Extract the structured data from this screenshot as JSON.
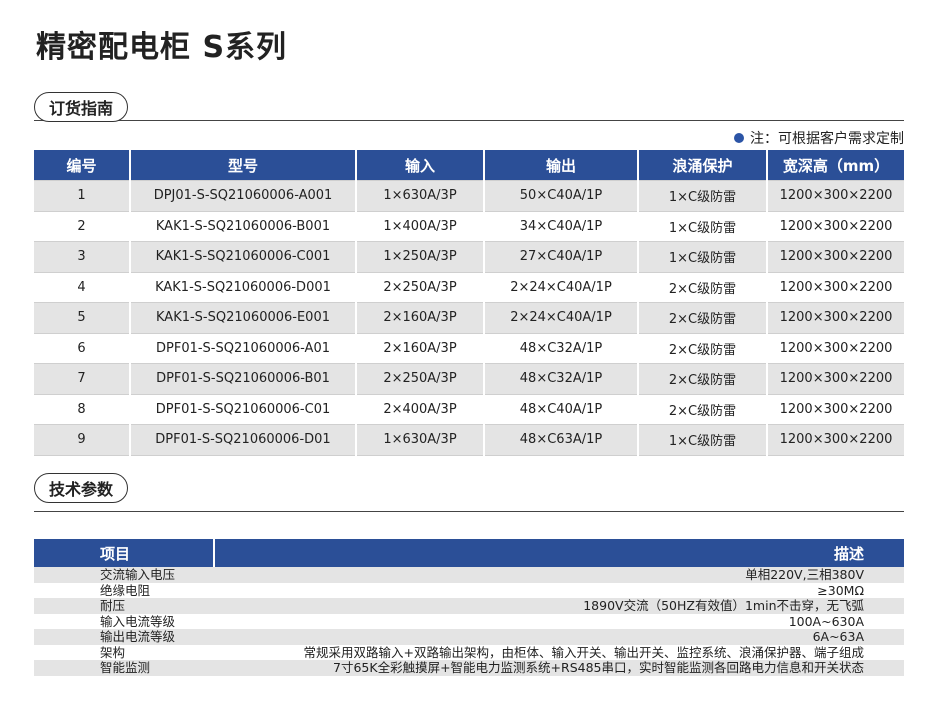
{
  "page": {
    "title": "精密配电柜 S系列"
  },
  "order_section": {
    "label": "订货指南",
    "note": "注：可根据客户需求定制",
    "columns": [
      "编号",
      "型号",
      "输入",
      "输出",
      "浪涌保护",
      "宽深高（mm）"
    ],
    "rows": [
      [
        "1",
        "DPJ01-S-SQ21060006-A001",
        "1×630A/3P",
        "50×C40A/1P",
        "1×C级防雷",
        "1200×300×2200"
      ],
      [
        "2",
        "KAK1-S-SQ21060006-B001",
        "1×400A/3P",
        "34×C40A/1P",
        "1×C级防雷",
        "1200×300×2200"
      ],
      [
        "3",
        "KAK1-S-SQ21060006-C001",
        "1×250A/3P",
        "27×C40A/1P",
        "1×C级防雷",
        "1200×300×2200"
      ],
      [
        "4",
        "KAK1-S-SQ21060006-D001",
        "2×250A/3P",
        "2×24×C40A/1P",
        "2×C级防雷",
        "1200×300×2200"
      ],
      [
        "5",
        "KAK1-S-SQ21060006-E001",
        "2×160A/3P",
        "2×24×C40A/1P",
        "2×C级防雷",
        "1200×300×2200"
      ],
      [
        "6",
        "DPF01-S-SQ21060006-A01",
        "2×160A/3P",
        "48×C32A/1P",
        "2×C级防雷",
        "1200×300×2200"
      ],
      [
        "7",
        "DPF01-S-SQ21060006-B01",
        "2×250A/3P",
        "48×C32A/1P",
        "2×C级防雷",
        "1200×300×2200"
      ],
      [
        "8",
        "DPF01-S-SQ21060006-C01",
        "2×400A/3P",
        "48×C40A/1P",
        "2×C级防雷",
        "1200×300×2200"
      ],
      [
        "9",
        "DPF01-S-SQ21060006-D01",
        "1×630A/3P",
        "48×C63A/1P",
        "1×C级防雷",
        "1200×300×2200"
      ]
    ]
  },
  "tech_section": {
    "label": "技术参数",
    "columns": [
      "项目",
      "描述"
    ],
    "rows": [
      [
        "交流输入电压",
        "单相220V,三相380V"
      ],
      [
        "绝缘电阻",
        "≥30MΩ"
      ],
      [
        "耐压",
        "1890V交流（50HZ有效值）1min不击穿，无飞弧"
      ],
      [
        "输入电流等级",
        "100A~630A"
      ],
      [
        "输出电流等级",
        "6A~63A"
      ],
      [
        "架构",
        "常规采用双路输入+双路输出架构，由柜体、输入开关、输出开关、监控系统、浪涌保护器、端子组成"
      ],
      [
        "智能监测",
        "7寸65K全彩触摸屏+智能电力监测系统+RS485串口，实时智能监测各回路电力信息和开关状态"
      ]
    ]
  },
  "colors": {
    "header_blue": "#2b4f97",
    "row_gray": "#e4e4e4",
    "note_dot": "#2b54a6"
  }
}
